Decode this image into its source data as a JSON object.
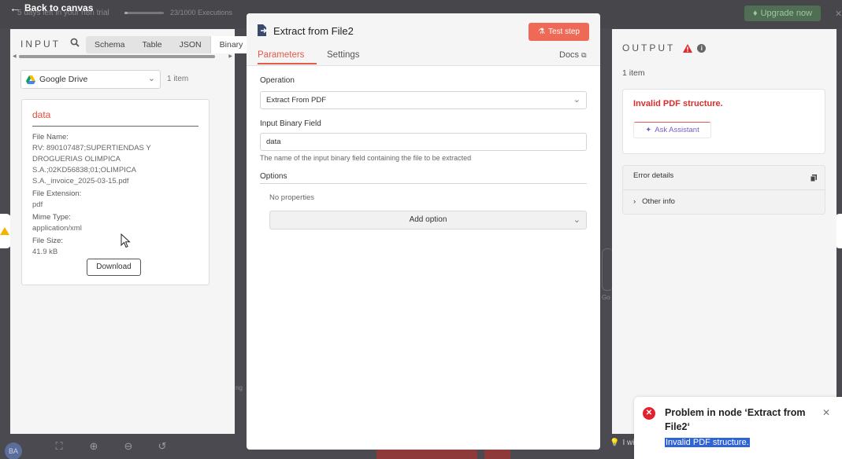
{
  "topbar": {
    "back_label": "Back to canvas",
    "trial_text": "5 days left in your n8n trial",
    "executions": "23/1000 Executions",
    "upgrade_label": "Upgrade now"
  },
  "canvas": {
    "avatar_initials": "BA",
    "partial_label_right": "Go",
    "partial_label_left": "ng",
    "partial_label_bottom": "I wi"
  },
  "input": {
    "title": "INPUT",
    "tabs": [
      "Schema",
      "Table",
      "JSON",
      "Binary"
    ],
    "active_tab": "Binary",
    "source_node": "Google Drive",
    "item_count": "1 item",
    "binary": {
      "key": "data",
      "file_name_label": "File Name:",
      "file_name_value": "RV: 890107487;SUPERTIENDAS Y DROGUERIAS OLIMPICA S.A.;02KD56838;01;OLIMPICA S.A._invoice_2025-03-15.pdf",
      "file_extension_label": "File Extension:",
      "file_extension_value": "pdf",
      "mime_type_label": "Mime Type:",
      "mime_type_value": "application/xml",
      "file_size_label": "File Size:",
      "file_size_value": "41.9 kB",
      "download_label": "Download"
    }
  },
  "node": {
    "title": "Extract from File2",
    "test_step_label": "Test step",
    "tabs": {
      "parameters": "Parameters",
      "settings": "Settings",
      "docs": "Docs"
    },
    "operation_label": "Operation",
    "operation_value": "Extract From PDF",
    "input_binary_label": "Input Binary Field",
    "input_binary_value": "data",
    "input_binary_hint": "The name of the input binary field containing the file to be extracted",
    "options_label": "Options",
    "no_properties": "No properties",
    "add_option_label": "Add option"
  },
  "output": {
    "title": "OUTPUT",
    "item_count": "1 item",
    "error_message": "Invalid PDF structure.",
    "ask_assistant_label": "Ask Assistant",
    "error_details_label": "Error details",
    "other_info_label": "Other info"
  },
  "toast": {
    "title": "Problem in node ‘Extract from File2‘",
    "message": "Invalid PDF structure."
  },
  "colors": {
    "accent": "#e5594b",
    "error": "#dd2c2c",
    "assistant": "#7a5cc9",
    "selection": "#2f64d6"
  }
}
